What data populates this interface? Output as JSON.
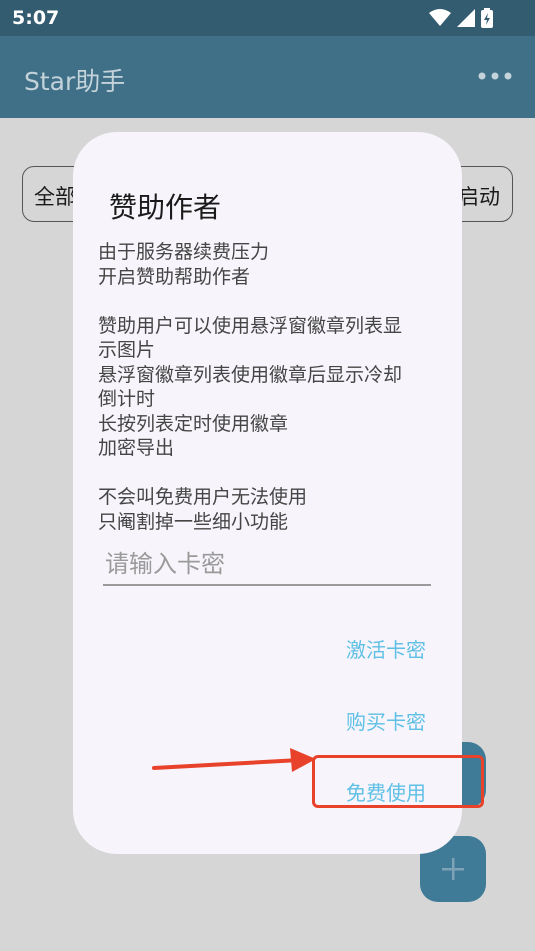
{
  "status_bar": {
    "time": "5:07"
  },
  "app_bar": {
    "title": "Star助手",
    "menu_icon": "more-dots-icon"
  },
  "filters": {
    "left_label": "全部",
    "right_label": "启动"
  },
  "fabs": {
    "add_icon": "plus-icon"
  },
  "dialog": {
    "title": "赞助作者",
    "paragraphs": [
      [
        "由于服务器续费压力",
        "开启赞助帮助作者"
      ],
      [
        "赞助用户可以使用悬浮窗徽章列表显",
        "示图片",
        "悬浮窗徽章列表使用徽章后显示冷却",
        "倒计时",
        "长按列表定时使用徽章",
        "加密导出"
      ],
      [
        "不会叫免费用户无法使用",
        "只阉割掉一些细小功能"
      ]
    ],
    "input": {
      "placeholder": "请输入卡密",
      "value": ""
    },
    "actions": {
      "activate": "激活卡密",
      "buy": "购买卡密",
      "free": "免费使用"
    }
  },
  "colors": {
    "app_bar": "#3f7088",
    "status_bar": "#345c70",
    "dialog_bg": "#f7f5fb",
    "action_text": "#5fc0e6",
    "annotation": "#e8432a"
  }
}
